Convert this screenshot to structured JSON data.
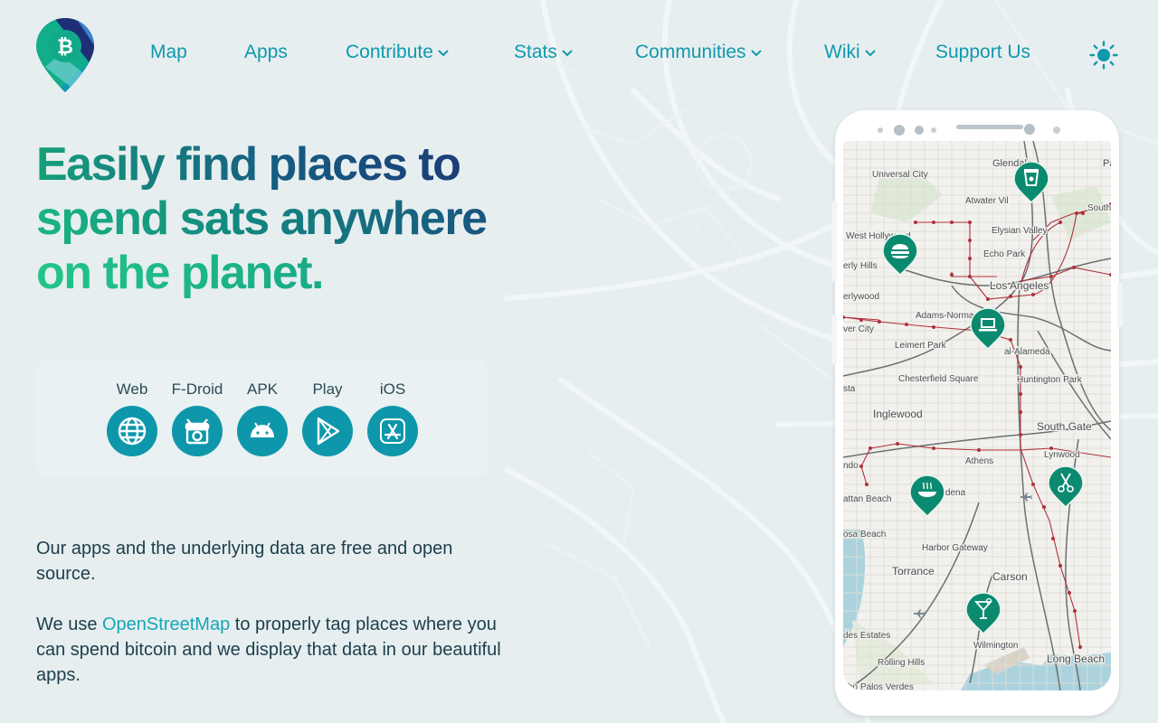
{
  "nav": {
    "items": [
      {
        "label": "Map",
        "has_dropdown": false
      },
      {
        "label": "Apps",
        "has_dropdown": false
      },
      {
        "label": "Contribute",
        "has_dropdown": true
      },
      {
        "label": "Stats",
        "has_dropdown": true
      },
      {
        "label": "Communities",
        "has_dropdown": true
      },
      {
        "label": "Wiki",
        "has_dropdown": true
      },
      {
        "label": "Support Us",
        "has_dropdown": false
      }
    ],
    "theme_icon": "sun-icon"
  },
  "hero": {
    "line1": "Easily find places to",
    "line2": "spend sats anywhere",
    "line3": "on the planet."
  },
  "apps": [
    {
      "label": "Web",
      "icon": "globe-icon"
    },
    {
      "label": "F-Droid",
      "icon": "fdroid-icon"
    },
    {
      "label": "APK",
      "icon": "android-icon"
    },
    {
      "label": "Play",
      "icon": "play-store-icon"
    },
    {
      "label": "iOS",
      "icon": "app-store-icon"
    }
  ],
  "body": {
    "p1": "Our apps and the underlying data are free and open source.",
    "p2_before": "We use ",
    "p2_link": "OpenStreetMap",
    "p2_after": " to properly tag places where you can spend bitcoin and we display that data in our beautiful apps."
  },
  "map": {
    "places": [
      "Glendale",
      "Universal City",
      "Atwater Vil",
      "Elysian Valley",
      "South",
      "West Hollywood",
      "Echo Park",
      "erly Hills",
      "Los Angeles",
      "erlywood",
      "Adams-Normandie",
      "ver City",
      "Leimert Park",
      "al-Alameda",
      "Chesterfield Square",
      "Huntington Park",
      "sta",
      "Inglewood",
      "South Gate",
      "Lynwood",
      "ndo",
      "Athens",
      "attan Beach",
      "ardena",
      "osa Beach",
      "Harbor Gateway",
      "Torrance",
      "Carson",
      "des Estates",
      "Wilmington",
      "Rolling Hills",
      "Long Beach",
      "cho Palos Verdes",
      "Pa"
    ]
  },
  "colors": {
    "accent": "#0f99ae",
    "pin": "#0b8a6f",
    "transit": "#b0303a",
    "background": "#e7eeef"
  }
}
